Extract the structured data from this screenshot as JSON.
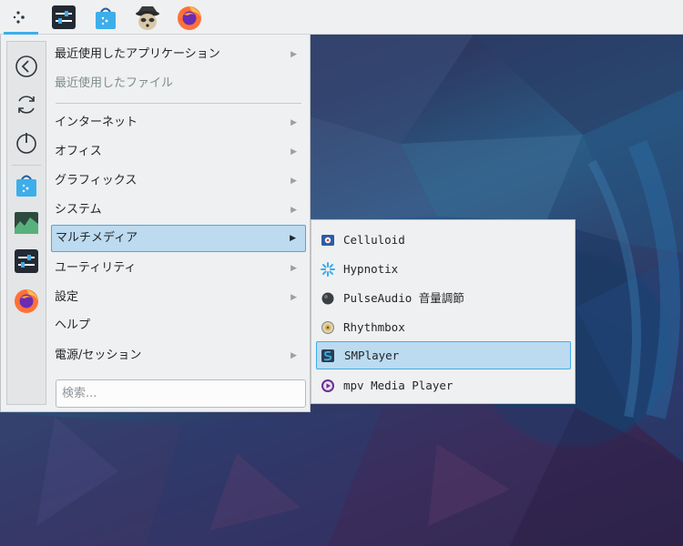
{
  "taskbar": {
    "items": [
      {
        "name": "launcher-icon"
      },
      {
        "name": "settings-sliders-icon"
      },
      {
        "name": "store-bag-icon"
      },
      {
        "name": "raccoon-avatar-icon"
      },
      {
        "name": "firefox-icon"
      }
    ]
  },
  "favorites": {
    "items": [
      {
        "name": "back-icon"
      },
      {
        "name": "refresh-icon"
      },
      {
        "name": "power-icon"
      },
      {
        "name": "store-bag-icon"
      },
      {
        "name": "system-monitor-icon"
      },
      {
        "name": "settings-sliders-icon"
      },
      {
        "name": "firefox-icon"
      }
    ]
  },
  "menu": {
    "items": [
      {
        "label": "最近使用したアプリケーション",
        "has_submenu": true
      },
      {
        "label": "最近使用したファイル",
        "has_submenu": false,
        "disabled": true
      },
      {
        "label": "インターネット",
        "has_submenu": true
      },
      {
        "label": "オフィス",
        "has_submenu": true
      },
      {
        "label": "グラフィックス",
        "has_submenu": true
      },
      {
        "label": "システム",
        "has_submenu": true
      },
      {
        "label": "マルチメディア",
        "has_submenu": true,
        "selected": true
      },
      {
        "label": "ユーティリティ",
        "has_submenu": true
      },
      {
        "label": "設定",
        "has_submenu": true
      },
      {
        "label": "ヘルプ",
        "has_submenu": false
      },
      {
        "label": "電源/セッション",
        "has_submenu": true
      }
    ],
    "arrow": "▶",
    "search_placeholder": "検索..."
  },
  "submenu": {
    "items": [
      {
        "label": "Celluloid",
        "icon": "celluloid-icon"
      },
      {
        "label": "Hypnotix",
        "icon": "hypnotix-icon"
      },
      {
        "label": "PulseAudio 音量調節",
        "icon": "pulseaudio-icon"
      },
      {
        "label": "Rhythmbox",
        "icon": "rhythmbox-icon"
      },
      {
        "label": "SMPlayer",
        "icon": "smplayer-icon",
        "selected": true
      },
      {
        "label": "mpv Media Player",
        "icon": "mpv-icon"
      }
    ]
  },
  "colors": {
    "accent": "#3daee9",
    "selection": "#bcdaf0",
    "panel": "#eff0f1"
  }
}
